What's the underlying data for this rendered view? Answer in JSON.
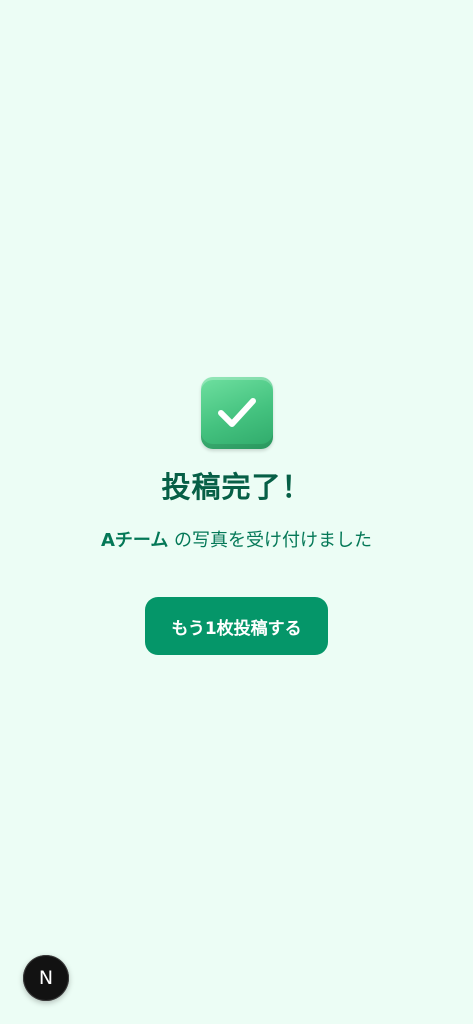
{
  "success": {
    "icon": "check-mark-button-icon",
    "title": "投稿完了！",
    "team_name": "Aチーム",
    "message_suffix": " の写真を受け付けました",
    "post_again_label": "もう1枚投稿する"
  },
  "dev_indicator": {
    "letter": "N",
    "icon": "next-logo-icon"
  },
  "colors": {
    "background": "#ecfdf5",
    "title": "#065f46",
    "message": "#047857",
    "button": "#059669",
    "button_text": "#ffffff",
    "check_tile": "#44c27f"
  }
}
